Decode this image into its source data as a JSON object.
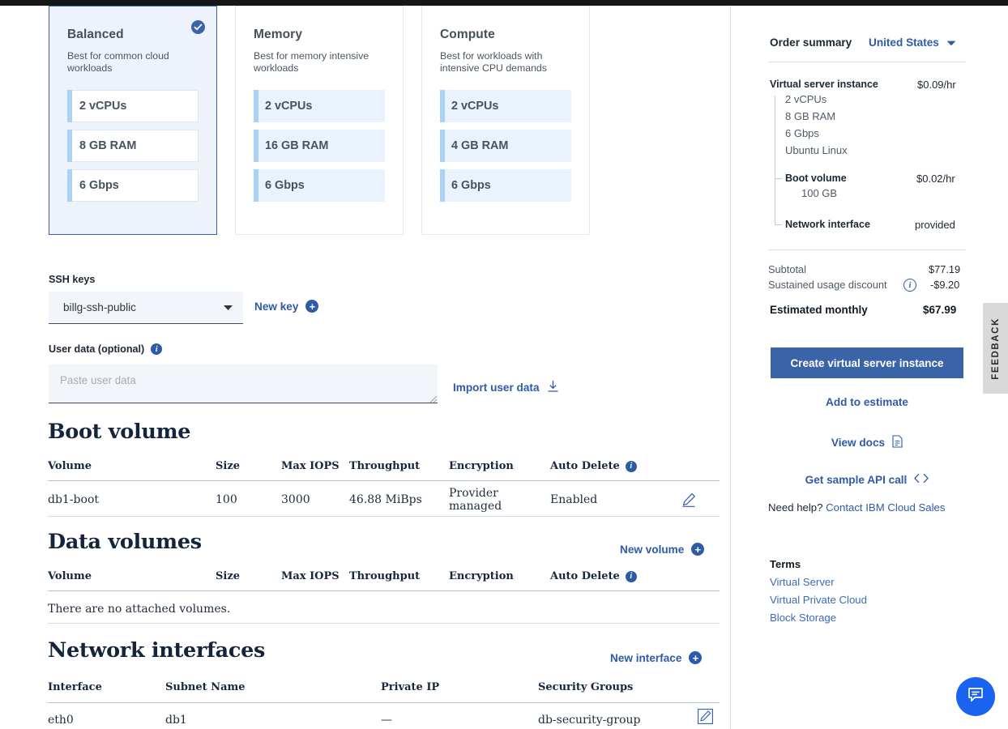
{
  "colors": {
    "accent": "#2f5aa8",
    "primary_button": "#3b63a8",
    "selected_card_bg": "#eef3fb",
    "spec_bar": "#a8d3f7",
    "chat_fab": "#1a62f0",
    "feedback_tab": "#d9d9d9"
  },
  "profiles": {
    "cards": [
      {
        "title": "Balanced",
        "description": "Best for common cloud workloads",
        "selected": true,
        "specs": [
          "2 vCPUs",
          "8 GB RAM",
          "6 Gbps"
        ],
        "check_icon": "check-circle-icon"
      },
      {
        "title": "Memory",
        "description": "Best for memory intensive workloads",
        "selected": false,
        "specs": [
          "2 vCPUs",
          "16 GB RAM",
          "6 Gbps"
        ]
      },
      {
        "title": "Compute",
        "description": "Best for workloads with intensive CPU demands",
        "selected": false,
        "specs": [
          "2 vCPUs",
          "4 GB RAM",
          "6 Gbps"
        ]
      }
    ]
  },
  "ssh": {
    "label": "SSH keys",
    "selected_key": "billg-ssh-public",
    "caret_icon": "chevron-down-icon",
    "new_key_label": "New key",
    "new_key_icon": "plus-circle-icon"
  },
  "user_data": {
    "label": "User data (optional)",
    "info_icon": "info-icon",
    "placeholder": "Paste user data",
    "value": "",
    "import_label": "Import user data",
    "import_icon": "download-icon"
  },
  "boot_volume": {
    "heading": "Boot volume",
    "columns": [
      "Volume",
      "Size",
      "Max IOPS",
      "Throughput",
      "Encryption",
      "Auto Delete"
    ],
    "auto_delete_info_icon": "info-icon",
    "rows": [
      {
        "volume": "db1-boot",
        "size": "100",
        "max_iops": "3000",
        "throughput": "46.88 MiBps",
        "encryption": "Provider managed",
        "auto_delete": "Enabled",
        "edit_icon": "edit-pencil-icon"
      }
    ]
  },
  "data_volumes": {
    "heading": "Data volumes",
    "new_label": "New volume",
    "new_icon": "plus-circle-icon",
    "columns": [
      "Volume",
      "Size",
      "Max IOPS",
      "Throughput",
      "Encryption",
      "Auto Delete"
    ],
    "auto_delete_info_icon": "info-icon",
    "empty_message": "There are no attached volumes."
  },
  "network_interfaces": {
    "heading": "Network interfaces",
    "new_label": "New interface",
    "new_icon": "plus-circle-icon",
    "columns": [
      "Interface",
      "Subnet Name",
      "Private IP",
      "Security Groups"
    ],
    "rows": [
      {
        "interface": "eth0",
        "subnet_name": "db1",
        "private_ip": "—",
        "security_groups": "db-security-group",
        "edit_icon": "edit-pencil-icon"
      }
    ]
  },
  "order_summary": {
    "title": "Order summary",
    "region": "United States",
    "region_caret_icon": "chevron-down-icon",
    "items": [
      {
        "name": "Virtual server instance",
        "price": "$0.09/hr",
        "details": [
          "2 vCPUs",
          "8 GB RAM",
          "6 Gbps",
          "Ubuntu Linux"
        ]
      },
      {
        "name": "Boot volume",
        "price": "$0.02/hr",
        "details": [
          "100 GB"
        ]
      },
      {
        "name": "Network interface",
        "price": "provided",
        "details": []
      }
    ],
    "totals": {
      "subtotal_label": "Subtotal",
      "subtotal_value": "$77.19",
      "discount_label": "Sustained usage discount",
      "discount_info_icon": "info-icon",
      "discount_value": "-$9.20",
      "estimated_label": "Estimated monthly",
      "estimated_value": "$67.99"
    },
    "actions": {
      "create_label": "Create virtual server instance",
      "estimate_label": "Add to estimate",
      "docs_label": "View docs",
      "docs_icon": "document-icon",
      "api_label": "Get sample API call",
      "api_icon": "code-icon"
    },
    "help": {
      "prefix": "Need help?",
      "link": "Contact IBM Cloud Sales"
    },
    "terms": {
      "title": "Terms",
      "links": [
        "Virtual Server",
        "Virtual Private Cloud",
        "Block Storage"
      ]
    }
  },
  "feedback_tab": {
    "label": "FEEDBACK"
  },
  "chat": {
    "icon": "chat-bubble-icon"
  }
}
